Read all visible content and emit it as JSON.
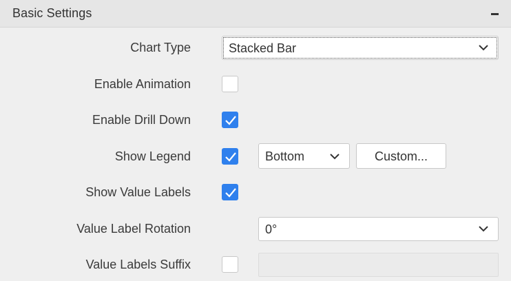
{
  "panel": {
    "title": "Basic Settings",
    "collapse_icon": "minus-icon"
  },
  "rows": {
    "chart_type": {
      "label": "Chart Type",
      "value": "Stacked Bar"
    },
    "enable_animation": {
      "label": "Enable Animation",
      "checked": false
    },
    "enable_drill_down": {
      "label": "Enable Drill Down",
      "checked": true
    },
    "show_legend": {
      "label": "Show Legend",
      "checked": true,
      "position_value": "Bottom",
      "custom_button": "Custom..."
    },
    "show_value_labels": {
      "label": "Show Value Labels",
      "checked": true
    },
    "value_label_rotation": {
      "label": "Value Label Rotation",
      "value": "0°"
    },
    "value_labels_suffix": {
      "label": "Value Labels Suffix",
      "checked": false,
      "text": ""
    }
  },
  "colors": {
    "accent": "#2f80ed",
    "background": "#efefef",
    "header": "#e6e6e6"
  }
}
